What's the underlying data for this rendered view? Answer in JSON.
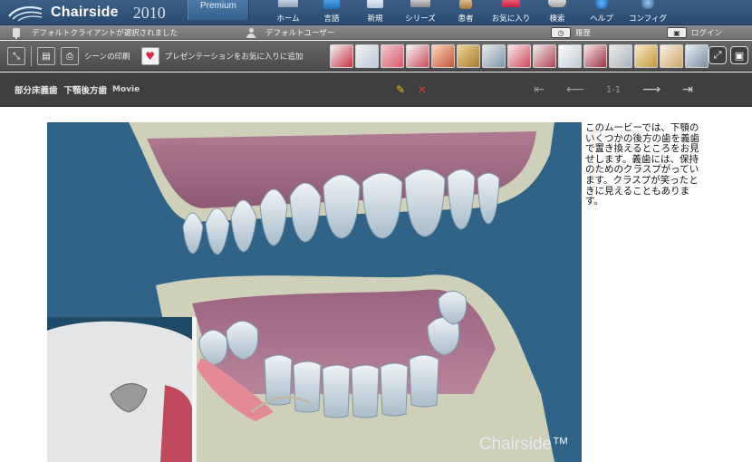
{
  "header": {
    "app_name": "Chairside",
    "year": "2010",
    "edition": "Premium",
    "nav": [
      {
        "label": "ホーム",
        "icon": "home-icon"
      },
      {
        "label": "言語",
        "icon": "globe-icon"
      },
      {
        "label": "新規",
        "icon": "new-document-icon"
      },
      {
        "label": "シリーズ",
        "icon": "film-icon"
      },
      {
        "label": "患者",
        "icon": "patient-icon"
      },
      {
        "label": "お気に入り",
        "icon": "favorites-icon"
      },
      {
        "label": "検索",
        "icon": "search-icon"
      },
      {
        "label": "ヘルプ",
        "icon": "help-icon"
      },
      {
        "label": "コンフィグ",
        "icon": "gear-icon"
      }
    ]
  },
  "status": {
    "client_text": "デフォルトクライアントが選択されました",
    "user_text": "デフォルトユーザー",
    "history_label": "履歴",
    "login_label": "ログイン"
  },
  "toolbar": {
    "print_label": "シーンの印刷",
    "favorite_label": "プレゼンテーションをお気に入りに追加",
    "thumbnails": [
      "tools",
      "crowns",
      "gums",
      "bite",
      "smile",
      "implant",
      "ortho",
      "veneers",
      "bridge",
      "whitening",
      "extraction",
      "dentures",
      "cleaning",
      "denture-upper",
      "xray"
    ]
  },
  "titlebar": {
    "title_part1": "部分床義歯",
    "title_part2": "下顎後方歯",
    "type_label": "Movie",
    "page_indicator": "1-1"
  },
  "content": {
    "watermark": "Chairside™",
    "description": "このムービーでは、下顎のいくつかの後方の歯を義歯で置き換えるところをお見せします。義歯には、保持のためのクラスプがっています。クラスプが笑ったときに見えることもあります。"
  },
  "colors": {
    "header_blue": "#2f5279",
    "toolbar_gray": "#555555",
    "scene_blue": "#2f6488"
  }
}
